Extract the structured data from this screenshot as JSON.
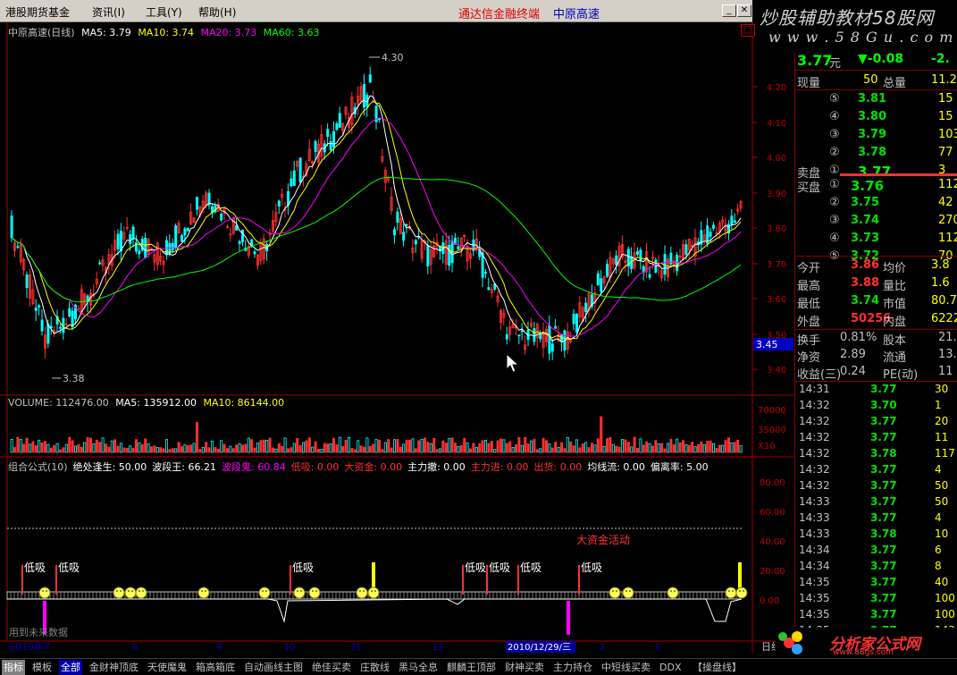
{
  "menu": {
    "items": [
      "港股期货基金",
      "资讯(I)",
      "工具(Y)",
      "帮助(H)"
    ],
    "title_red": "通达信金融终端",
    "title_blue": "中原高速"
  },
  "brand": {
    "line1": "炒股辅助教材58股网",
    "line2": "w w w . 5 8 G u . c o m"
  },
  "main": {
    "label": "中原高速(日线)",
    "ma5": "MA5: 3.79",
    "ma10": "MA10: 3.74",
    "ma20": "MA20: 3.73",
    "ma60": "MA60: 3.63",
    "high_mark": "4.30",
    "low_mark": "3.38",
    "price_ticks": [
      "4.20",
      "4.10",
      "4.00",
      "3.90",
      "3.80",
      "3.70",
      "3.60",
      "3.50",
      "3.40"
    ],
    "current_tag": "3.45"
  },
  "volume": {
    "label": "VOLUME: 112476.00",
    "ma5": "MA5: 135912.00",
    "ma10": "MA10: 86144.00",
    "ticks": [
      "70000",
      "35000"
    ],
    "unit": "X10"
  },
  "indicator": {
    "header": [
      {
        "t": "组合公式(10)",
        "c": "#c0c0c0"
      },
      {
        "t": "绝处逢生: 50.00",
        "c": "#ffffff"
      },
      {
        "t": "波段王: 66.21",
        "c": "#ffffff"
      },
      {
        "t": "波段鬼: 60.84",
        "c": "#ff00ff"
      },
      {
        "t": "低吸: 0.00",
        "c": "#ff3030"
      },
      {
        "t": "大资金: 0.00",
        "c": "#ff3030"
      },
      {
        "t": "主力撤: 0.00",
        "c": "#ffffff"
      },
      {
        "t": "主力进: 0.00",
        "c": "#ff3030"
      },
      {
        "t": "出货: 0.00",
        "c": "#ff3030"
      },
      {
        "t": "均线流: 0.00",
        "c": "#ffffff"
      },
      {
        "t": "偏离率: 5.00",
        "c": "#ffffff"
      }
    ],
    "ticks": [
      "80.00",
      "60.00",
      "40.00",
      "20.00",
      "0.00"
    ],
    "signal": "低吸",
    "big_money": "大资金活动"
  },
  "footer": {
    "nodata": "用到未来数据",
    "date_start": "2010年7",
    "date_cursor": "2010/12/29/三",
    "months": [
      "8",
      "9",
      "10",
      "11",
      "12",
      "2",
      "3"
    ],
    "right": "日线"
  },
  "quote": {
    "price": "3.77",
    "unit": "元",
    "change": "▼-0.08",
    "change_pct": "-2.",
    "vol_label": "现量",
    "vol": "50",
    "total_label": "总量",
    "total": "11.2",
    "sell_label": "卖盘",
    "buy_label": "买盘",
    "asks": [
      {
        "lvl": "⑤",
        "p": "3.81",
        "v": "15"
      },
      {
        "lvl": "④",
        "p": "3.80",
        "v": "15"
      },
      {
        "lvl": "③",
        "p": "3.79",
        "v": "103"
      },
      {
        "lvl": "②",
        "p": "3.78",
        "v": "77"
      },
      {
        "lvl": "①",
        "p": "3.77",
        "v": "3"
      }
    ],
    "bids": [
      {
        "lvl": "①",
        "p": "3.76",
        "v": "112"
      },
      {
        "lvl": "②",
        "p": "3.75",
        "v": "42"
      },
      {
        "lvl": "③",
        "p": "3.74",
        "v": "270"
      },
      {
        "lvl": "④",
        "p": "3.73",
        "v": "112"
      },
      {
        "lvl": "⑤",
        "p": "3.72",
        "v": "70"
      }
    ],
    "stats": [
      {
        "l1": "今开",
        "v1": "3.86",
        "c1": "#ff3030",
        "l2": "均价",
        "v2": "3.8"
      },
      {
        "l1": "最高",
        "v1": "3.88",
        "c1": "#ff3030",
        "l2": "量比",
        "v2": "1.6"
      },
      {
        "l1": "最低",
        "v1": "3.74",
        "c1": "#00e000",
        "l2": "市值",
        "v2": "80.7"
      },
      {
        "l1": "外盘",
        "v1": "50256",
        "c1": "#ff3030",
        "l2": "内盘",
        "v2": "6222"
      }
    ],
    "stats2": [
      {
        "l1": "换手",
        "v1": "0.81%",
        "l2": "股本",
        "v2": "21.4"
      },
      {
        "l1": "净资",
        "v1": "2.89",
        "l2": "流通",
        "v2": "13.9"
      },
      {
        "l1": "收益(三)",
        "v1": "0.24",
        "l2": "PE(动)",
        "v2": "11"
      }
    ],
    "ticks": [
      {
        "t": "14:31",
        "p": "3.77",
        "v": "30"
      },
      {
        "t": "14:32",
        "p": "3.70",
        "v": "1"
      },
      {
        "t": "14:32",
        "p": "3.77",
        "v": "20"
      },
      {
        "t": "14:32",
        "p": "3.77",
        "v": "11"
      },
      {
        "t": "14:32",
        "p": "3.78",
        "v": "117"
      },
      {
        "t": "14:32",
        "p": "3.77",
        "v": "4"
      },
      {
        "t": "14:32",
        "p": "3.77",
        "v": "50"
      },
      {
        "t": "14:33",
        "p": "3.77",
        "v": "50"
      },
      {
        "t": "14:33",
        "p": "3.77",
        "v": "4"
      },
      {
        "t": "14:33",
        "p": "3.78",
        "v": "10"
      },
      {
        "t": "14:34",
        "p": "3.77",
        "v": "6"
      },
      {
        "t": "14:34",
        "p": "3.77",
        "v": "8"
      },
      {
        "t": "14:35",
        "p": "3.77",
        "v": "40"
      },
      {
        "t": "14:35",
        "p": "3.77",
        "v": "100"
      },
      {
        "t": "14:35",
        "p": "3.77",
        "v": "100"
      },
      {
        "t": "14:35",
        "p": "3.77",
        "v": "143"
      }
    ]
  },
  "tabs": [
    "指标",
    "模板",
    "全部",
    "金财神顶底",
    "天使魔鬼",
    "箱高箱底",
    "自动画线主图",
    "绝佳买卖",
    "庄散线",
    "黑马全息",
    "麒麟王顶部",
    "财神买卖",
    "主力持仓",
    "中短线买卖",
    "DDX",
    "【操盘线】"
  ],
  "logo": "分析家公式网",
  "logo_url": "www.88gs.com",
  "colors": {
    "up": "#ff3030",
    "down": "#00ffff",
    "ma5": "#ffffff",
    "ma10": "#ffff00",
    "ma20": "#ff00ff",
    "ma60": "#00ff00"
  }
}
